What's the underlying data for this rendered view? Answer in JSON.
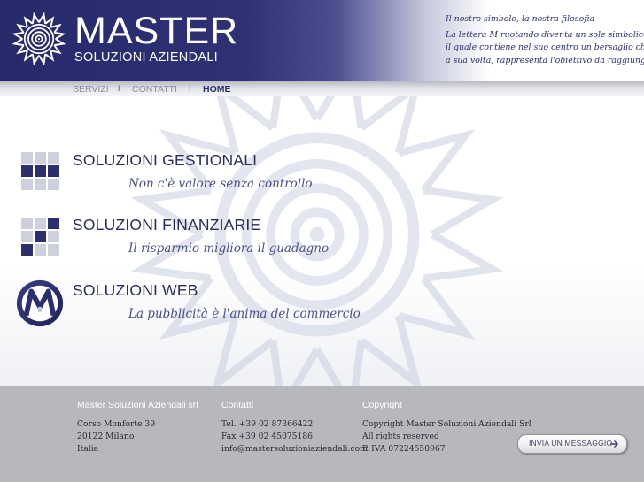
{
  "brand": {
    "title": "MASTER",
    "subtitle": "SOLUZIONI AZIENDALI",
    "emblem_icon": "sun-target-logo-icon"
  },
  "motto": {
    "title": "Il nostro simbolo, la nostra filosofia",
    "lines": [
      "La lettera M ruotando diventa un sole simbolico",
      "il quale contiene nel suo centro un bersaglio che,",
      "a sua volta, rappresenta l'obiettivo da raggiungere."
    ]
  },
  "nav": {
    "items": [
      "SERVIZI",
      "CONTATTI",
      "HOME"
    ],
    "separator": "I",
    "active": "HOME"
  },
  "services": [
    {
      "title": "SOLUZIONI GESTIONALI",
      "tagline": "Non c'è valore senza controllo",
      "icon": "grid-squares-icon"
    },
    {
      "title": "SOLUZIONI FINANZIARIE",
      "tagline": "Il risparmio migliora il guadagno",
      "icon": "checker-squares-icon"
    },
    {
      "title": "SOLUZIONI WEB",
      "tagline": "La pubblicità è l'anima del commercio",
      "icon": "m-circle-logo-icon"
    }
  ],
  "footer": {
    "company": {
      "heading": "Master Soluzioni Aziendali srl",
      "lines": [
        "Corso Monforte 39",
        "20122 Milano",
        "Italia"
      ]
    },
    "contacts": {
      "heading": "Contatti",
      "lines": [
        "Tel. +39 02 87366422",
        "Fax +39 02 45075186",
        "info@mastersoluzioniaziendali.com"
      ]
    },
    "copyright": {
      "heading": "Copyright",
      "lines": [
        "Copyright Master Soluzioni Aziendali Srl",
        "All rights reserved",
        "P. IVA 07224550967"
      ]
    },
    "send_button": "INVIA UN MESSAGGIO"
  },
  "colors": {
    "brand_navy": "#2e3275",
    "footer_gray": "#b7b8bd",
    "tagline_blue": "#4a4f8c"
  }
}
